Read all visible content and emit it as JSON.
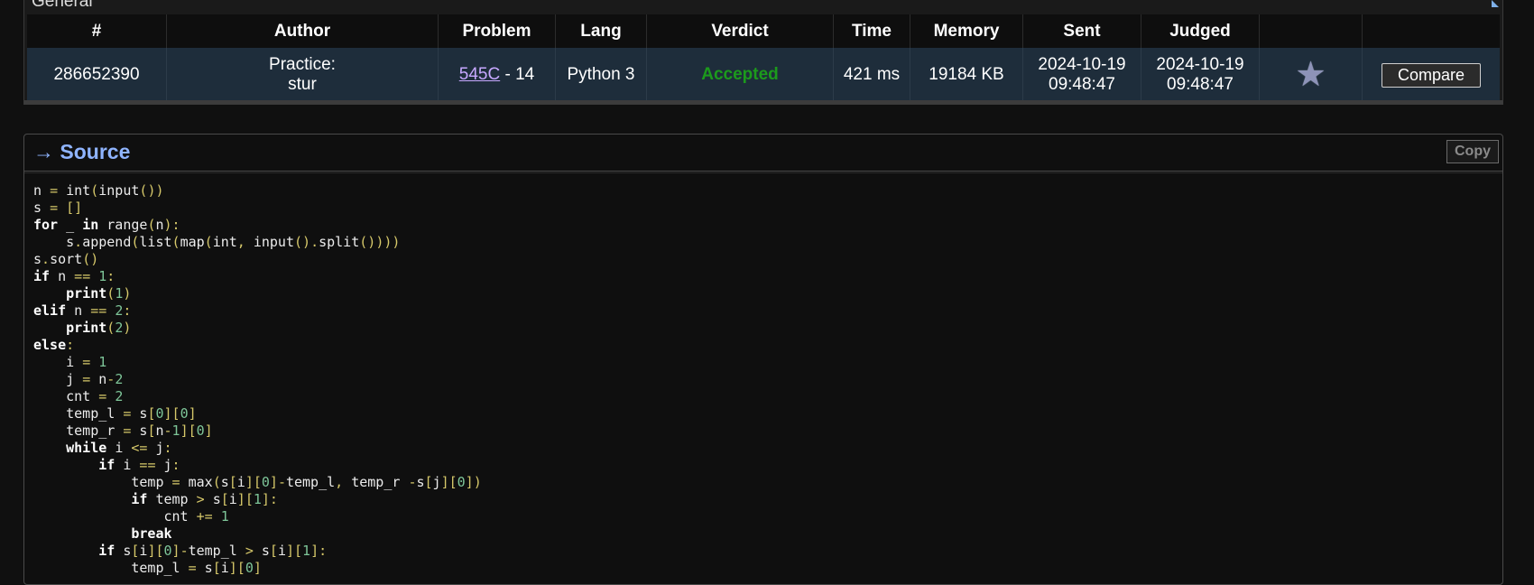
{
  "general": {
    "title": "General",
    "columns": [
      "#",
      "Author",
      "Problem",
      "Lang",
      "Verdict",
      "Time",
      "Memory",
      "Sent",
      "Judged",
      "",
      ""
    ],
    "submission": {
      "id": "286652390",
      "author_line1": "Practice:",
      "author_line2": "stur",
      "problem_link": "545C",
      "problem_suffix": " - 14",
      "lang": "Python 3",
      "verdict": "Accepted",
      "time": "421 ms",
      "memory": "19184 KB",
      "sent_date": "2024-10-19",
      "sent_time": "09:48:47",
      "judged_date": "2024-10-19",
      "judged_time": "09:48:47",
      "star_icon": "star-icon",
      "compare_label": "Compare"
    }
  },
  "source": {
    "title": "→ Source",
    "copy_label": "Copy",
    "code_lines": [
      "n = int(input())",
      "s = []",
      "for _ in range(n):",
      "    s.append(list(map(int, input().split())))",
      "s.sort()",
      "if n == 1:",
      "    print(1)",
      "elif n == 2:",
      "    print(2)",
      "else:",
      "    i = 1",
      "    j = n-2",
      "    cnt = 2",
      "    temp_l = s[0][0]",
      "    temp_r = s[n-1][0]",
      "    while i <= j:",
      "        if i == j:",
      "            temp = max(s[i][0]-temp_l, temp_r -s[j][0])",
      "            if temp > s[i][1]:",
      "                cnt += 1",
      "            break",
      "        if s[i][0]-temp_l > s[i][1]:",
      "            temp_l = s[i][0]"
    ]
  },
  "colors": {
    "source_title": "#8fb4ff",
    "verdict_accepted": "#1c9a1c",
    "row_bg": "#1e2d3b",
    "problem_link": "#c7a8ff"
  }
}
